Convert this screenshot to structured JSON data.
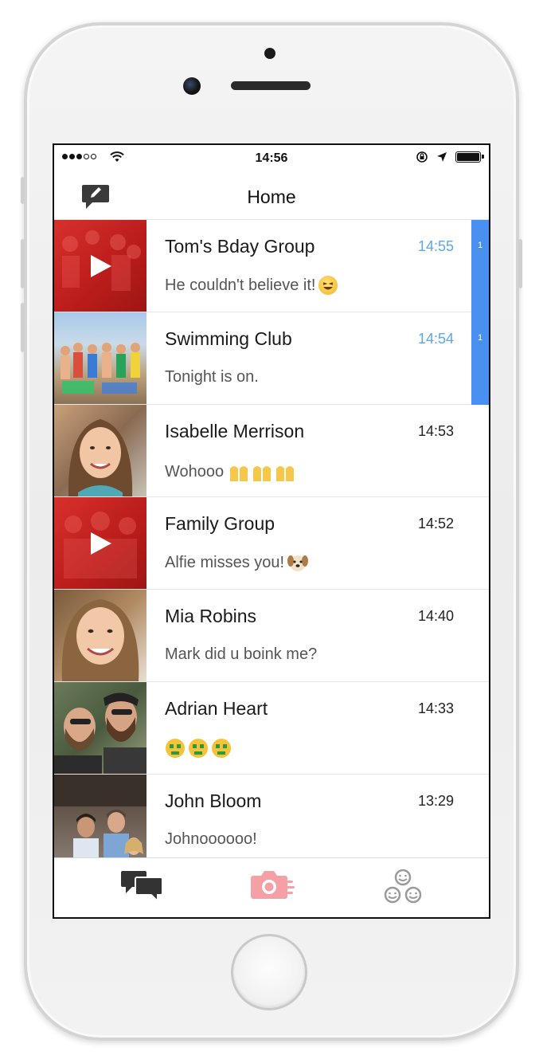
{
  "status_bar": {
    "time": "14:56"
  },
  "nav": {
    "title": "Home"
  },
  "conversations": [
    {
      "name": "Tom's Bday Group",
      "message": "He couldn't believe it!",
      "time": "14:55",
      "unread": true,
      "badge": "1",
      "thumb": "video"
    },
    {
      "name": "Swimming Club",
      "message": "Tonight is on.",
      "time": "14:54",
      "unread": true,
      "badge": "1",
      "thumb": "group-beach"
    },
    {
      "name": "Isabelle Merrison",
      "message": "Wohooo",
      "time": "14:53",
      "unread": false,
      "badge": "",
      "thumb": "portrait"
    },
    {
      "name": "Family Group",
      "message": "Alfie misses you!",
      "time": "14:52",
      "unread": false,
      "badge": "",
      "thumb": "video"
    },
    {
      "name": "Mia Robins",
      "message": "Mark did u boink me?",
      "time": "14:40",
      "unread": false,
      "badge": "",
      "thumb": "portrait"
    },
    {
      "name": "Adrian Heart",
      "message": "",
      "time": "14:33",
      "unread": false,
      "badge": "",
      "thumb": "duo"
    },
    {
      "name": "John Bloom",
      "message": "Johnoooooo!",
      "time": "13:29",
      "unread": false,
      "badge": "",
      "thumb": "trio"
    }
  ],
  "colors": {
    "accent_blue": "#4a90f0",
    "unread_time": "#5aa6f0",
    "video_red": "#c8221f",
    "camera_pink": "#f4a0a4"
  },
  "icons": {
    "compose": "compose-bubble-icon",
    "chats_tab": "chat-bubbles-icon",
    "camera_tab": "camera-icon",
    "friends_tab": "people-group-icon"
  }
}
